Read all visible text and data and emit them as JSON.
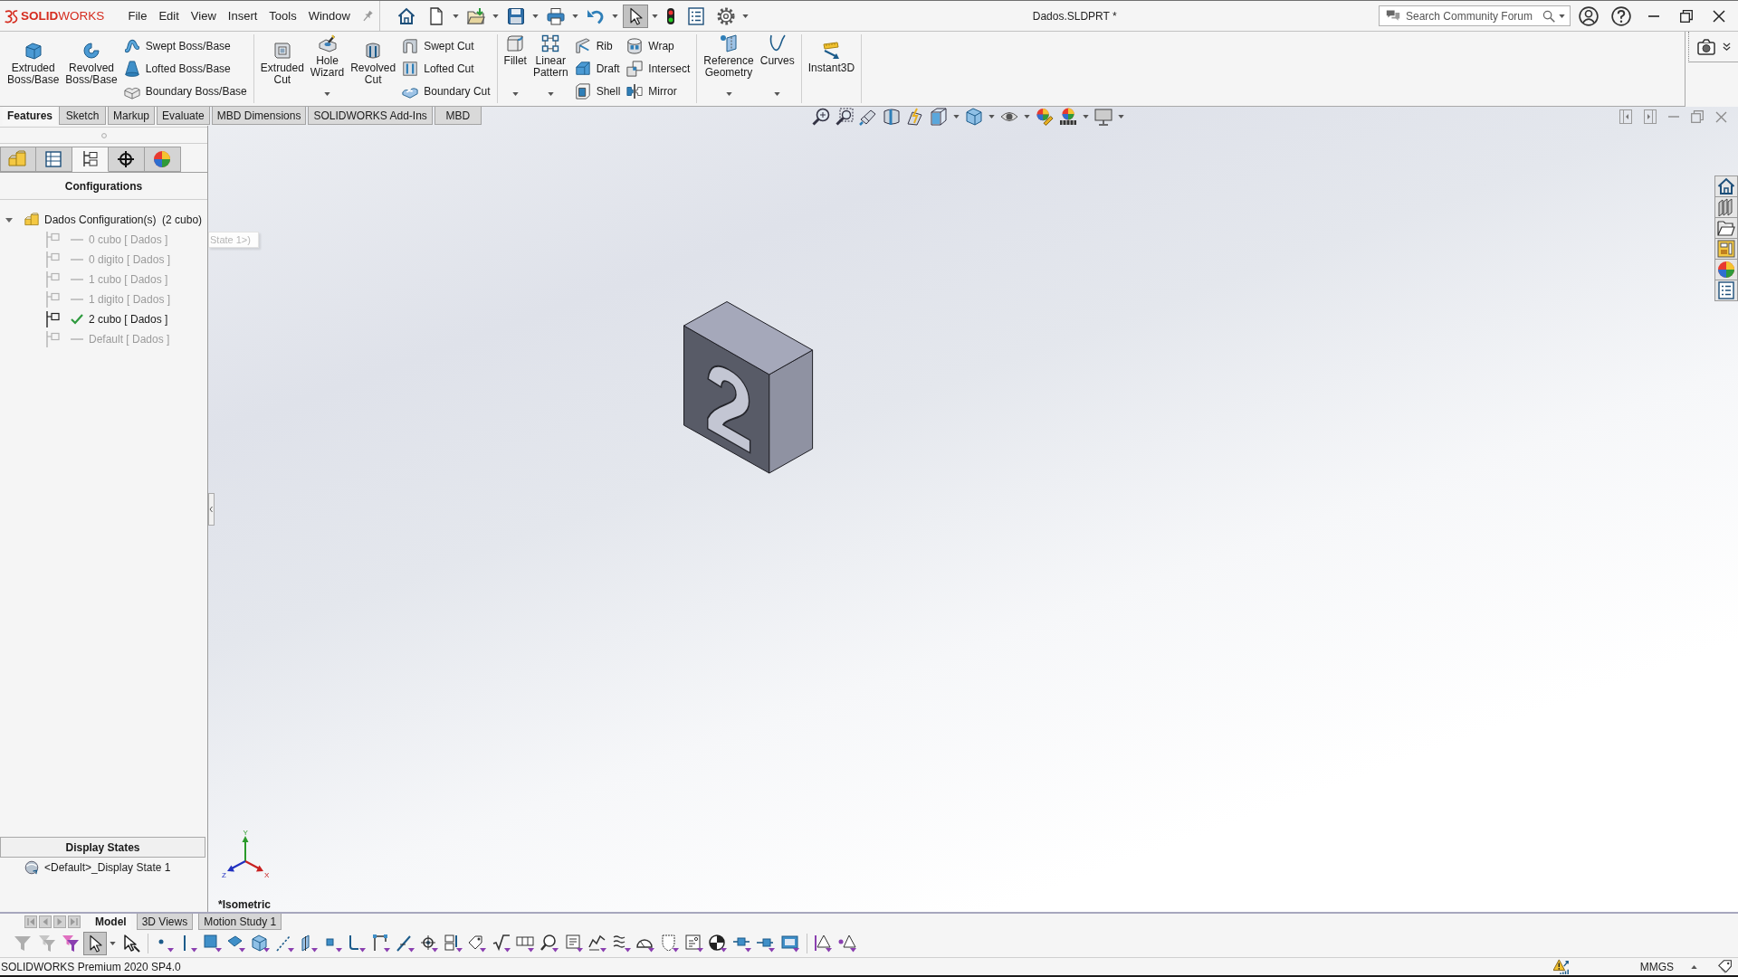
{
  "app": {
    "logo": "**SOLID**WORKS",
    "menus": [
      "File",
      "Edit",
      "View",
      "Insert",
      "Tools",
      "Window"
    ],
    "quick_access": [
      {
        "dropdown": false,
        "selected": false
      },
      {
        "dropdown": true,
        "selected": false
      },
      {
        "dropdown": true,
        "selected": false
      },
      {
        "dropdown": true,
        "selected": false
      },
      {
        "dropdown": true,
        "selected": false
      },
      {
        "dropdown": true,
        "selected": false
      },
      {
        "dropdown": true,
        "selected": true
      },
      {
        "dropdown": false,
        "selected": false
      },
      {
        "dropdown": false,
        "selected": false
      },
      {
        "dropdown": true,
        "selected": false
      }
    ],
    "document_title": "Dados.SLDPRT *",
    "search": {
      "placeholder": "Search Community Forum"
    }
  },
  "ribbon": {
    "groups": [
      {
        "items": [
          {
            "kind": "large",
            "label": "Extruded Boss/Base",
            "dropdown": false
          },
          {
            "kind": "large",
            "label": "Revolved Boss/Base",
            "dropdown": false
          },
          {
            "kind": "stack",
            "items": [
              "Swept Boss/Base",
              "Lofted Boss/Base",
              "Boundary Boss/Base"
            ]
          }
        ]
      },
      {
        "items": [
          {
            "kind": "large",
            "label": "Extruded Cut",
            "dropdown": false
          },
          {
            "kind": "large",
            "label": "Hole Wizard",
            "dropdown": true
          },
          {
            "kind": "large",
            "label": "Revolved Cut",
            "dropdown": false
          },
          {
            "kind": "stack",
            "items": [
              "Swept Cut",
              "Lofted Cut",
              "Boundary Cut"
            ]
          }
        ]
      },
      {
        "items": [
          {
            "kind": "large",
            "label": "Fillet",
            "dropdown": true
          },
          {
            "kind": "large",
            "label": "Linear Pattern",
            "dropdown": true
          },
          {
            "kind": "stack",
            "items": [
              "Rib",
              "Draft",
              "Shell"
            ]
          },
          {
            "kind": "stack",
            "items": [
              "Wrap",
              "Intersect",
              "Mirror"
            ]
          }
        ]
      },
      {
        "items": [
          {
            "kind": "large",
            "label": "Reference Geometry",
            "dropdown": true
          },
          {
            "kind": "large",
            "label": "Curves",
            "dropdown": true
          }
        ]
      },
      {
        "items": [
          {
            "kind": "large",
            "label": "Instant3D",
            "dropdown": false
          }
        ]
      }
    ]
  },
  "command_tabs": [
    {
      "label": "Features",
      "selected": true
    },
    {
      "label": "Sketch",
      "selected": false
    },
    {
      "label": "Markup",
      "selected": false
    },
    {
      "label": "Evaluate",
      "selected": false
    },
    {
      "label": "MBD Dimensions",
      "selected": false
    },
    {
      "label": "SOLIDWORKS Add-Ins",
      "selected": false
    },
    {
      "label": "MBD",
      "selected": false
    }
  ],
  "feature_manager": {
    "panel_tabs": [
      {
        "selected": false
      },
      {
        "selected": false
      },
      {
        "selected": true
      },
      {
        "selected": false
      },
      {
        "selected": false
      }
    ],
    "title": "Configurations",
    "tree": {
      "label": "Dados Configuration(s)  (2 cubo)",
      "expanded": true,
      "children": [
        {
          "label": "0 cubo [ Dados ]",
          "active": false
        },
        {
          "label": "0 digito [ Dados ]",
          "active": false
        },
        {
          "label": "1 cubo [ Dados ]",
          "active": false
        },
        {
          "label": "1 digito [ Dados ]",
          "active": false
        },
        {
          "label": "2 cubo [ Dados ]",
          "active": true
        },
        {
          "label": "Default [ Dados ]",
          "active": false
        }
      ]
    },
    "display_states": {
      "title": "Display States",
      "items": [
        "<Default>_Display State 1"
      ]
    }
  },
  "viewport": {
    "tooltip": "State 1>)",
    "model": {
      "engraving": "2"
    },
    "triad": {
      "x": "X",
      "y": "Y",
      "z": "Z"
    },
    "view_label": "*Isometric"
  },
  "bottom_tabs": [
    {
      "label": "Model",
      "selected": true
    },
    {
      "label": "3D Views",
      "selected": false
    },
    {
      "label": "Motion Study 1",
      "selected": false
    }
  ],
  "selection_filter": {
    "tools": [
      {
        "disabled": true,
        "selected": false,
        "dropdown": false
      },
      {
        "disabled": true,
        "selected": false,
        "dropdown": false
      },
      {
        "disabled": false,
        "selected": false,
        "dropdown": false
      },
      {
        "disabled": false,
        "selected": true,
        "dropdown": true
      },
      {
        "disabled": false,
        "selected": false,
        "dropdown": false
      }
    ]
  },
  "status_bar": {
    "product": "SOLIDWORKS Premium 2020 SP4.0",
    "units": "MMGS"
  }
}
